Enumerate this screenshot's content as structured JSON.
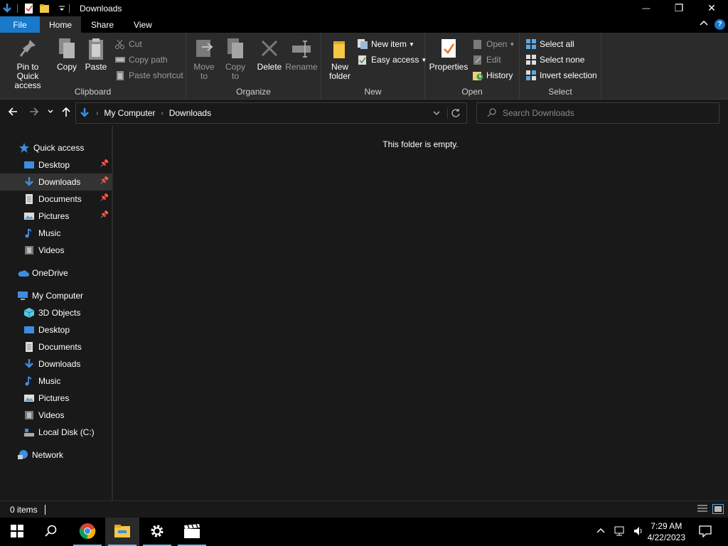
{
  "window": {
    "title": "Downloads",
    "minimize_glyph": "—",
    "restore_glyph": "❐",
    "close_glyph": "✕"
  },
  "ribbon_tabs": {
    "file": "File",
    "home": "Home",
    "share": "Share",
    "view": "View"
  },
  "ribbon": {
    "clipboard": {
      "label": "Clipboard",
      "pin_quick_access": "Pin to Quick access",
      "copy": "Copy",
      "paste": "Paste",
      "cut": "Cut",
      "copy_path": "Copy path",
      "paste_shortcut": "Paste shortcut"
    },
    "organize": {
      "label": "Organize",
      "move_to": "Move to",
      "copy_to": "Copy to",
      "delete": "Delete",
      "rename": "Rename"
    },
    "new": {
      "label": "New",
      "new_folder": "New folder",
      "new_item": "New item",
      "easy_access": "Easy access"
    },
    "open": {
      "label": "Open",
      "properties": "Properties",
      "open": "Open",
      "edit": "Edit",
      "history": "History"
    },
    "select": {
      "label": "Select",
      "select_all": "Select all",
      "select_none": "Select none",
      "invert_selection": "Invert selection"
    }
  },
  "address": {
    "crumbs": [
      "My Computer",
      "Downloads"
    ],
    "search_placeholder": "Search Downloads"
  },
  "nav_pane": {
    "quick_access": "Quick access",
    "quick_items": [
      {
        "label": "Desktop",
        "pinned": true
      },
      {
        "label": "Downloads",
        "pinned": true,
        "selected": true
      },
      {
        "label": "Documents",
        "pinned": true
      },
      {
        "label": "Pictures",
        "pinned": true
      },
      {
        "label": "Music",
        "pinned": false
      },
      {
        "label": "Videos",
        "pinned": false
      }
    ],
    "onedrive": "OneDrive",
    "my_computer": "My Computer",
    "computer_items": [
      {
        "label": "3D Objects"
      },
      {
        "label": "Desktop"
      },
      {
        "label": "Documents"
      },
      {
        "label": "Downloads"
      },
      {
        "label": "Music"
      },
      {
        "label": "Pictures"
      },
      {
        "label": "Videos"
      },
      {
        "label": "Local Disk (C:)"
      }
    ],
    "network": "Network"
  },
  "content": {
    "empty_message": "This folder is empty."
  },
  "status": {
    "item_count": "0 items"
  },
  "taskbar": {
    "time": "7:29 AM",
    "date": "4/22/2023"
  },
  "colors": {
    "accent": "#1979ca",
    "folder_yellow": "#f7c843",
    "download_blue": "#3d8de0"
  }
}
